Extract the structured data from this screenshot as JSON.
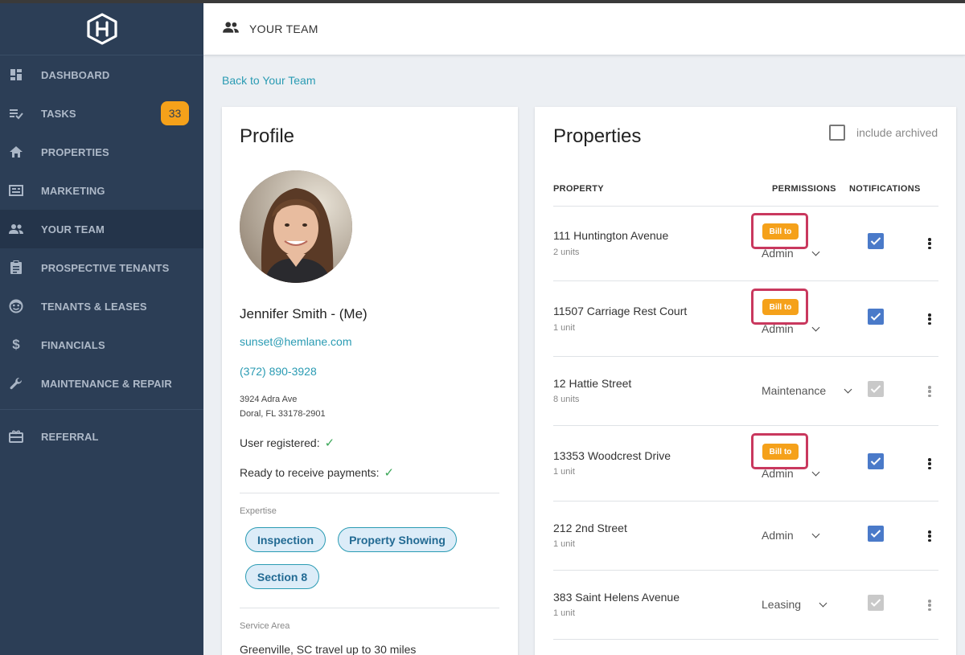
{
  "sidebar": {
    "items": [
      {
        "label": "DASHBOARD",
        "icon": "dashboard-icon"
      },
      {
        "label": "TASKS",
        "icon": "tasks-icon",
        "badge": "33"
      },
      {
        "label": "PROPERTIES",
        "icon": "home-icon"
      },
      {
        "label": "MARKETING",
        "icon": "marketing-icon"
      },
      {
        "label": "YOUR TEAM",
        "icon": "team-icon",
        "active": true
      },
      {
        "label": "PROSPECTIVE TENANTS",
        "icon": "clipboard-icon"
      },
      {
        "label": "TENANTS & LEASES",
        "icon": "face-icon"
      },
      {
        "label": "FINANCIALS",
        "icon": "dollar-icon"
      },
      {
        "label": "MAINTENANCE & REPAIR",
        "icon": "wrench-icon"
      }
    ],
    "referral": {
      "label": "REFERRAL",
      "icon": "gift-icon"
    }
  },
  "header": {
    "title": "YOUR TEAM",
    "icon": "team-icon"
  },
  "back_link": "Back to Your Team",
  "profile": {
    "title": "Profile",
    "name": "Jennifer Smith - (Me)",
    "email": "sunset@hemlane.com",
    "phone": "(372) 890-3928",
    "address_line1": "3924 Adra Ave",
    "address_line2": "Doral, FL 33178-2901",
    "user_registered": "User registered:",
    "ready_payments": "Ready to receive payments:",
    "expertise_label": "Expertise",
    "expertise": [
      "Inspection",
      "Property Showing",
      "Section 8"
    ],
    "service_area_label": "Service Area",
    "service_area": "Greenville, SC travel up to 30 miles"
  },
  "properties": {
    "title": "Properties",
    "include_archived": "include archived",
    "columns": {
      "property": "PROPERTY",
      "permissions": "PERMISSIONS",
      "notifications": "NOTIFICATIONS"
    },
    "bill_to_label": "Bill to",
    "rows": [
      {
        "name": "111 Huntington Avenue",
        "units": "2 units",
        "permission": "Admin",
        "bill_to": true,
        "notifications": true
      },
      {
        "name": "11507 Carriage Rest Court",
        "units": "1 unit",
        "permission": "Admin",
        "bill_to": true,
        "notifications": true
      },
      {
        "name": "12 Hattie Street",
        "units": "8 units",
        "permission": "Maintenance",
        "bill_to": false,
        "notifications": true,
        "disabled": true
      },
      {
        "name": "13353 Woodcrest Drive",
        "units": "1 unit",
        "permission": "Admin",
        "bill_to": true,
        "notifications": true
      },
      {
        "name": "212 2nd Street",
        "units": "1 unit",
        "permission": "Admin",
        "bill_to": false,
        "notifications": true
      },
      {
        "name": "383 Saint Helens Avenue",
        "units": "1 unit",
        "permission": "Leasing",
        "bill_to": false,
        "notifications": true,
        "disabled": true
      }
    ]
  },
  "colors": {
    "sidebar_bg": "#2c3e56",
    "accent_link": "#2a9bb3",
    "badge_orange": "#f5a11a",
    "highlight_red": "#c9385e",
    "checkbox_blue": "#4a7ac9"
  }
}
